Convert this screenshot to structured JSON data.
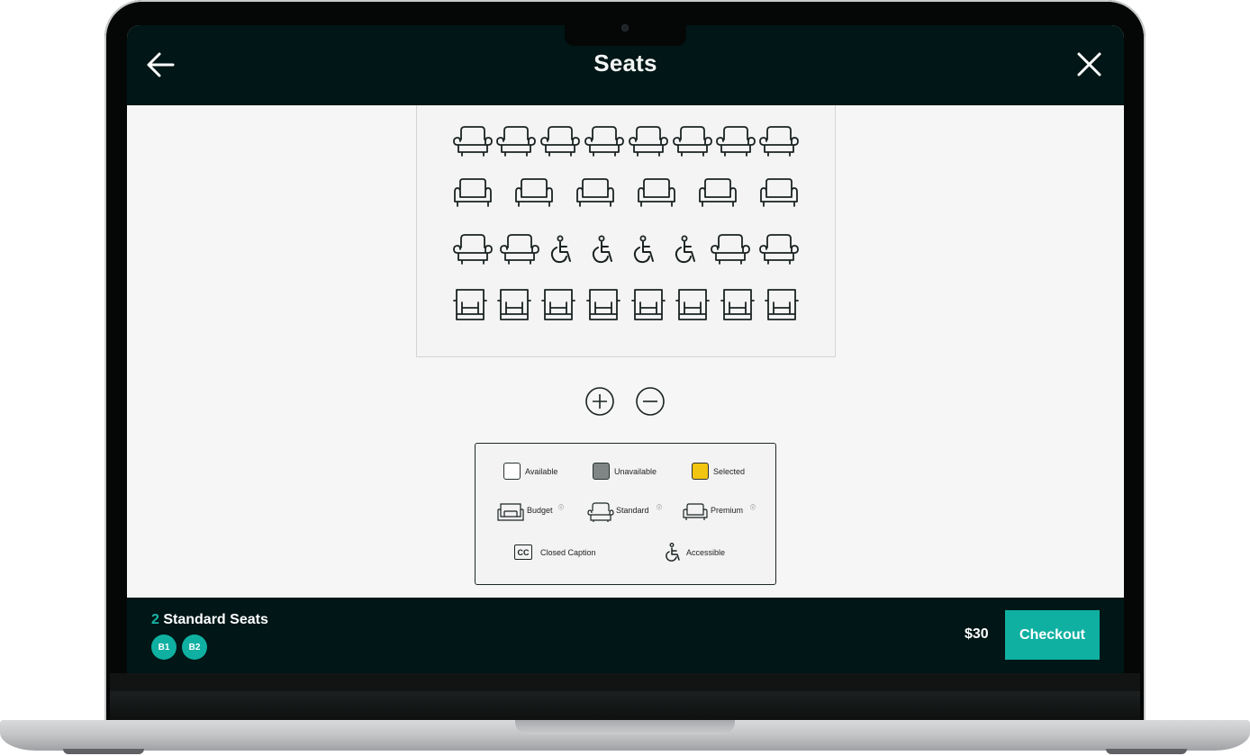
{
  "header": {
    "title": "Seats",
    "back_icon": "arrow-left-icon",
    "close_icon": "close-icon"
  },
  "seat_map": {
    "rows": [
      {
        "seat_type": "standard",
        "seats": [
          "standard",
          "standard",
          "standard",
          "standard",
          "standard",
          "standard",
          "standard",
          "standard"
        ]
      },
      {
        "seat_type": "premium",
        "seats": [
          "premium",
          "premium",
          "premium",
          "premium",
          "premium",
          "premium"
        ]
      },
      {
        "seat_type": "mixed",
        "seats": [
          "standard",
          "standard",
          "accessible",
          "accessible",
          "accessible",
          "accessible",
          "standard",
          "standard"
        ]
      },
      {
        "seat_type": "budget",
        "seats": [
          "budget",
          "budget",
          "budget",
          "budget",
          "budget",
          "budget",
          "budget",
          "budget"
        ]
      }
    ]
  },
  "zoom": {
    "in_icon": "zoom-in-icon",
    "out_icon": "zoom-out-icon"
  },
  "legend": {
    "available": "Available",
    "unavailable": "Unavailable",
    "selected": "Selected",
    "budget": "Budget",
    "standard": "Standard",
    "premium": "Premium",
    "closed_caption": "Closed Caption",
    "cc_badge": "CC",
    "accessible": "Accessible",
    "info_glyph": "ⓘ",
    "colors": {
      "available": "#ffffff",
      "unavailable": "#7f8685",
      "selected": "#f2c511"
    }
  },
  "footer": {
    "count": "2",
    "count_label": "Standard Seats",
    "chips": [
      "B1",
      "B2"
    ],
    "price": "$30",
    "checkout_label": "Checkout"
  },
  "colors": {
    "header_bg": "#011616",
    "accent": "#0fb0a1"
  }
}
